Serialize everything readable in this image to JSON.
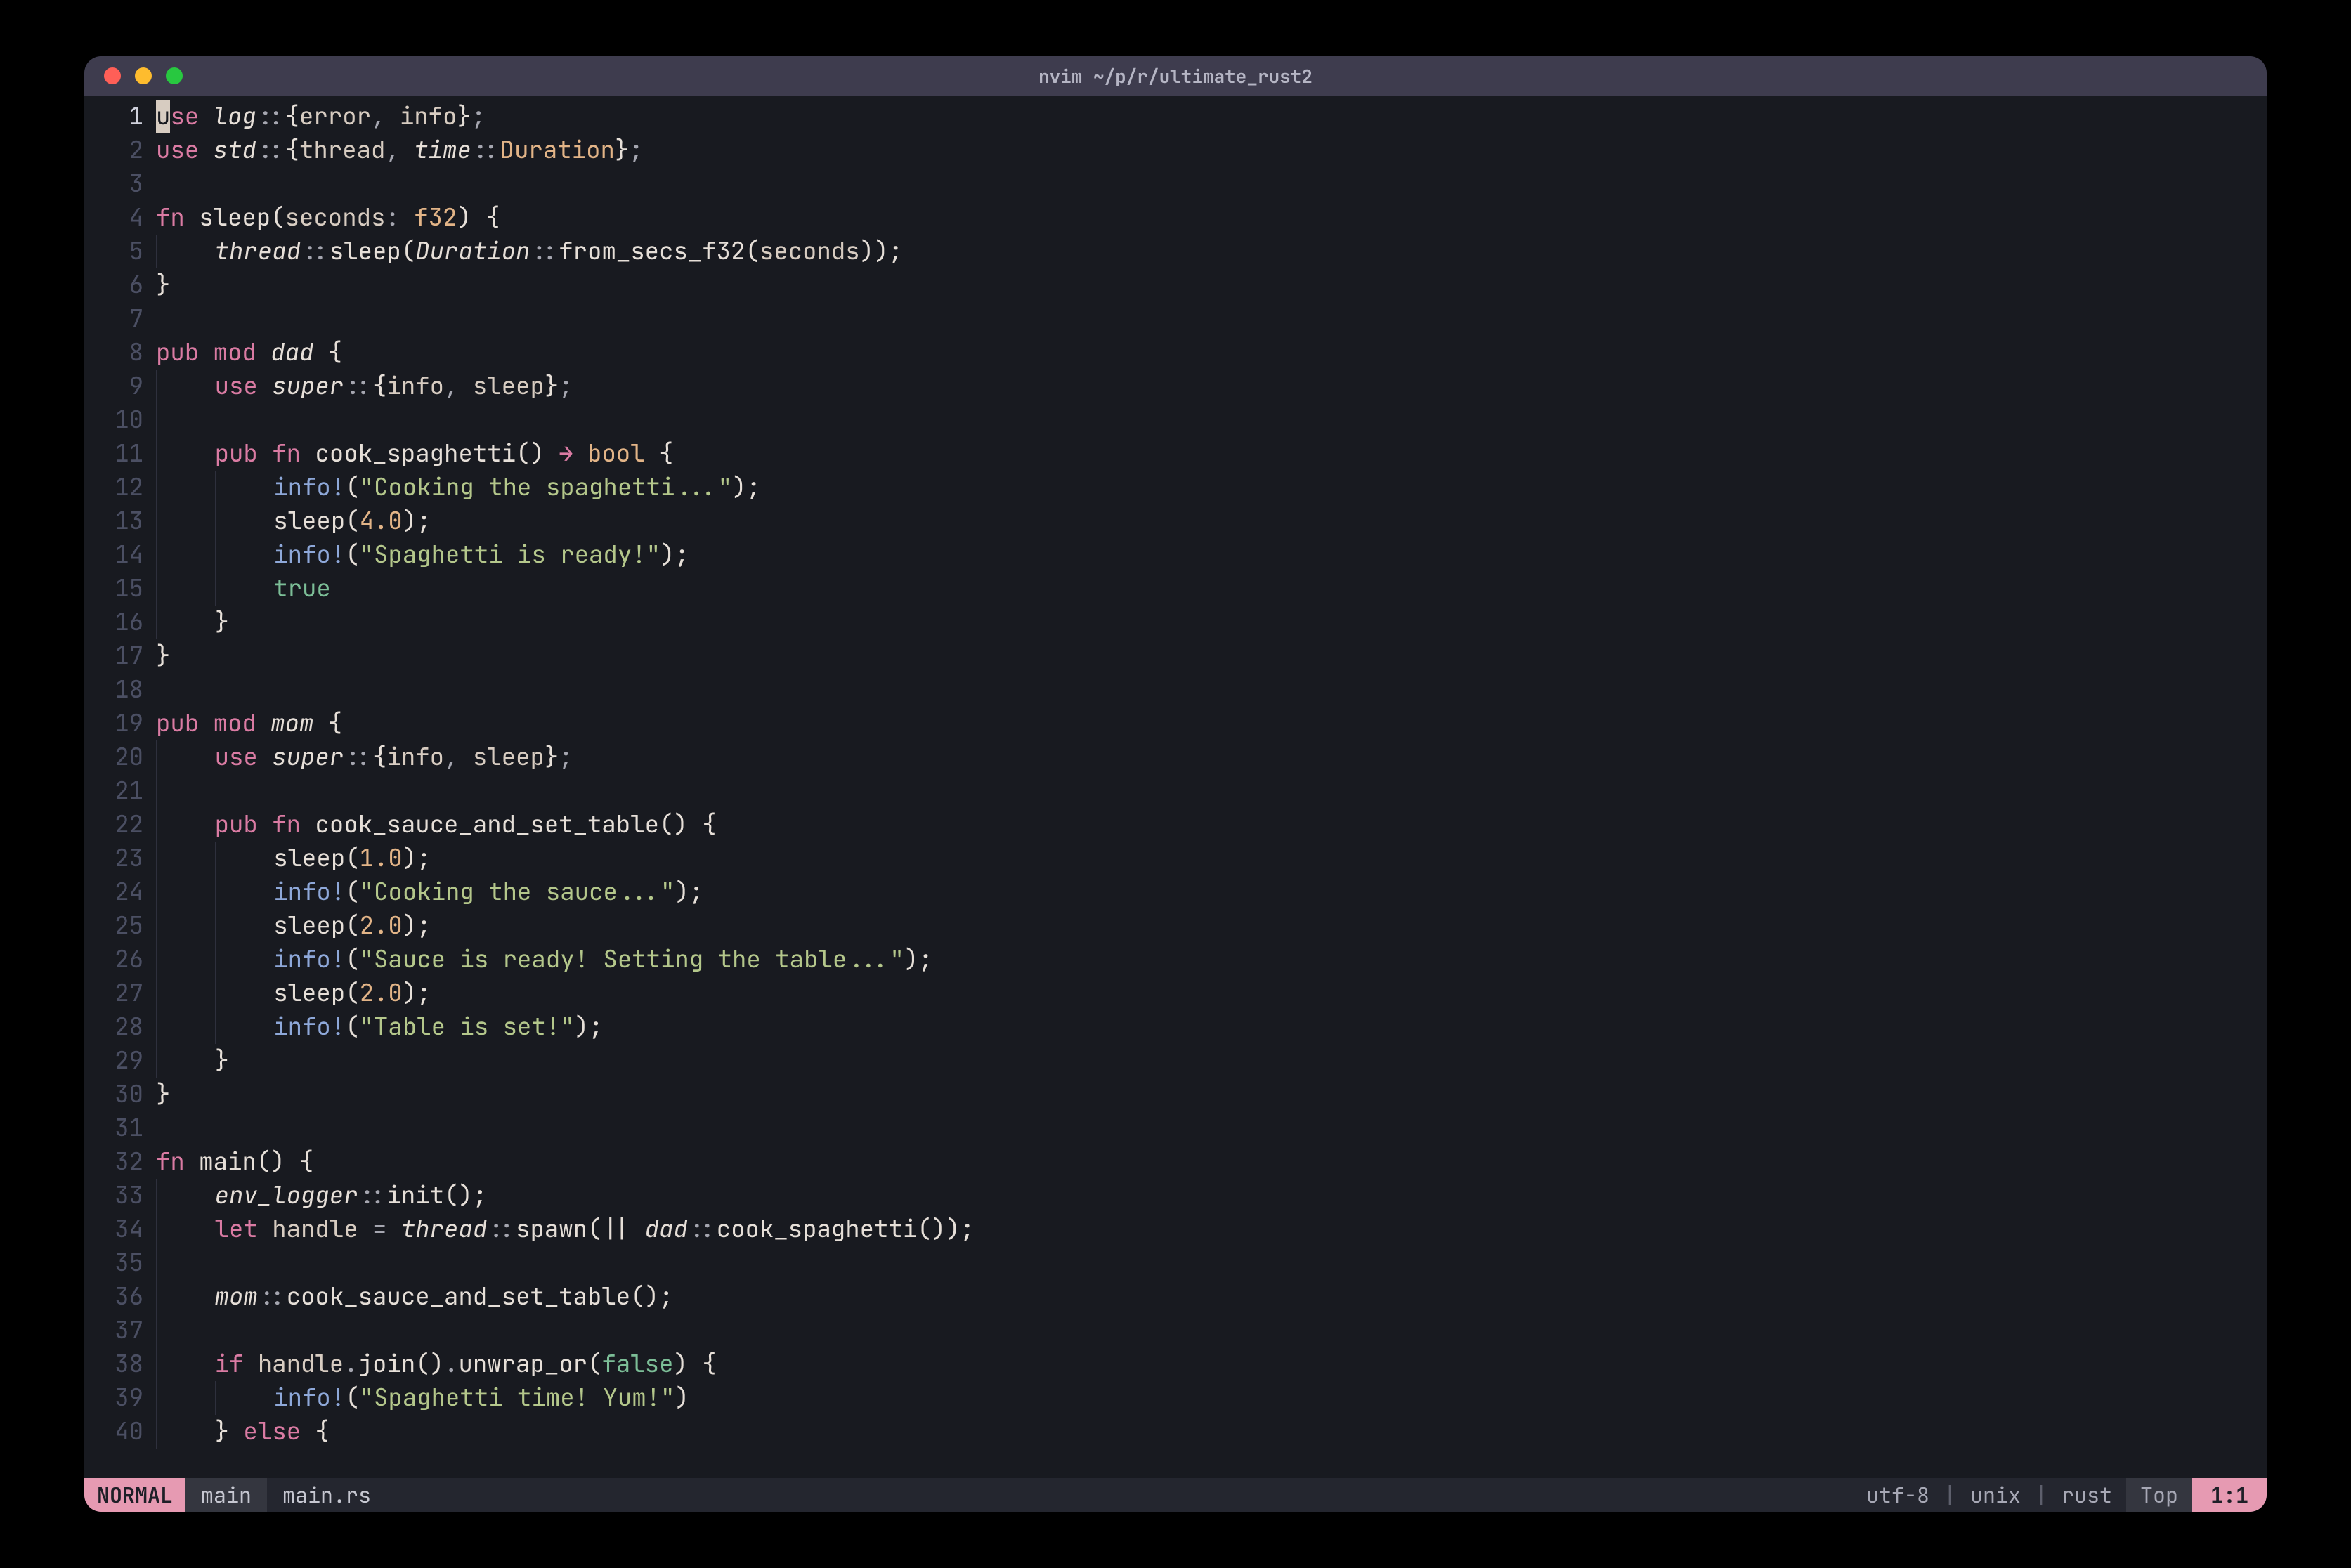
{
  "window": {
    "title": "nvim ~/p/r/ultimate_rust2"
  },
  "editor": {
    "first_line": 1,
    "last_line": 40,
    "cursor_line": 1,
    "lines": [
      {
        "n": 1,
        "tokens": [
          [
            "cursor",
            "u"
          ],
          [
            "kw",
            "se "
          ],
          [
            "it",
            "log"
          ],
          [
            "punct",
            "::"
          ],
          [
            "delim",
            "{"
          ],
          [
            "id",
            "error"
          ],
          [
            "punct",
            ", "
          ],
          [
            "id",
            "info"
          ],
          [
            "delim",
            "}"
          ],
          [
            "punct",
            ";"
          ]
        ]
      },
      {
        "n": 2,
        "tokens": [
          [
            "kw",
            "use "
          ],
          [
            "it",
            "std"
          ],
          [
            "punct",
            "::"
          ],
          [
            "delim",
            "{"
          ],
          [
            "id",
            "thread"
          ],
          [
            "punct",
            ", "
          ],
          [
            "it",
            "time"
          ],
          [
            "punct",
            "::"
          ],
          [
            "type",
            "Duration"
          ],
          [
            "delim",
            "}"
          ],
          [
            "punct",
            ";"
          ]
        ]
      },
      {
        "n": 3,
        "tokens": []
      },
      {
        "n": 4,
        "tokens": [
          [
            "kw",
            "fn "
          ],
          [
            "fn",
            "sleep"
          ],
          [
            "delim",
            "("
          ],
          [
            "id",
            "seconds"
          ],
          [
            "punct",
            ": "
          ],
          [
            "type",
            "f32"
          ],
          [
            "delim",
            ") {"
          ]
        ]
      },
      {
        "n": 5,
        "indent": 1,
        "tokens": [
          [
            "it",
            "thread"
          ],
          [
            "punct",
            "::"
          ],
          [
            "fn",
            "sleep"
          ],
          [
            "delim",
            "("
          ],
          [
            "it",
            "Duration"
          ],
          [
            "punct",
            "::"
          ],
          [
            "fn",
            "from_secs_f32"
          ],
          [
            "delim",
            "("
          ],
          [
            "id",
            "seconds"
          ],
          [
            "delim",
            "));"
          ]
        ]
      },
      {
        "n": 6,
        "tokens": [
          [
            "delim",
            "}"
          ]
        ]
      },
      {
        "n": 7,
        "tokens": []
      },
      {
        "n": 8,
        "tokens": [
          [
            "kw",
            "pub mod "
          ],
          [
            "it",
            "dad"
          ],
          [
            "delim",
            " {"
          ]
        ]
      },
      {
        "n": 9,
        "indent": 1,
        "tokens": [
          [
            "kw",
            "use "
          ],
          [
            "it",
            "super"
          ],
          [
            "punct",
            "::"
          ],
          [
            "delim",
            "{"
          ],
          [
            "id",
            "info"
          ],
          [
            "punct",
            ", "
          ],
          [
            "id",
            "sleep"
          ],
          [
            "delim",
            "}"
          ],
          [
            "punct",
            ";"
          ]
        ]
      },
      {
        "n": 10,
        "indent": 1,
        "tokens": []
      },
      {
        "n": 11,
        "indent": 1,
        "tokens": [
          [
            "kw",
            "pub fn "
          ],
          [
            "fn",
            "cook_spaghetti"
          ],
          [
            "delim",
            "() "
          ],
          [
            "op",
            "→"
          ],
          [
            "delim",
            " "
          ],
          [
            "type",
            "bool"
          ],
          [
            "delim",
            " {"
          ]
        ]
      },
      {
        "n": 12,
        "indent": 2,
        "tokens": [
          [
            "macro",
            "info!"
          ],
          [
            "delim",
            "("
          ],
          [
            "str",
            "\"Cooking the spaghetti...\""
          ],
          [
            "delim",
            ");"
          ]
        ]
      },
      {
        "n": 13,
        "indent": 2,
        "tokens": [
          [
            "fn",
            "sleep"
          ],
          [
            "delim",
            "("
          ],
          [
            "num",
            "4.0"
          ],
          [
            "delim",
            ");"
          ]
        ]
      },
      {
        "n": 14,
        "indent": 2,
        "tokens": [
          [
            "macro",
            "info!"
          ],
          [
            "delim",
            "("
          ],
          [
            "str",
            "\"Spaghetti is ready!\""
          ],
          [
            "delim",
            ");"
          ]
        ]
      },
      {
        "n": 15,
        "indent": 2,
        "tokens": [
          [
            "kw2",
            "true"
          ]
        ]
      },
      {
        "n": 16,
        "indent": 1,
        "tokens": [
          [
            "delim",
            "}"
          ]
        ]
      },
      {
        "n": 17,
        "tokens": [
          [
            "delim",
            "}"
          ]
        ]
      },
      {
        "n": 18,
        "tokens": []
      },
      {
        "n": 19,
        "tokens": [
          [
            "kw",
            "pub mod "
          ],
          [
            "it",
            "mom"
          ],
          [
            "delim",
            " {"
          ]
        ]
      },
      {
        "n": 20,
        "indent": 1,
        "tokens": [
          [
            "kw",
            "use "
          ],
          [
            "it",
            "super"
          ],
          [
            "punct",
            "::"
          ],
          [
            "delim",
            "{"
          ],
          [
            "id",
            "info"
          ],
          [
            "punct",
            ", "
          ],
          [
            "id",
            "sleep"
          ],
          [
            "delim",
            "}"
          ],
          [
            "punct",
            ";"
          ]
        ]
      },
      {
        "n": 21,
        "indent": 1,
        "tokens": []
      },
      {
        "n": 22,
        "indent": 1,
        "tokens": [
          [
            "kw",
            "pub fn "
          ],
          [
            "fn",
            "cook_sauce_and_set_table"
          ],
          [
            "delim",
            "() {"
          ]
        ]
      },
      {
        "n": 23,
        "indent": 2,
        "tokens": [
          [
            "fn",
            "sleep"
          ],
          [
            "delim",
            "("
          ],
          [
            "num",
            "1.0"
          ],
          [
            "delim",
            ");"
          ]
        ]
      },
      {
        "n": 24,
        "indent": 2,
        "tokens": [
          [
            "macro",
            "info!"
          ],
          [
            "delim",
            "("
          ],
          [
            "str",
            "\"Cooking the sauce...\""
          ],
          [
            "delim",
            ");"
          ]
        ]
      },
      {
        "n": 25,
        "indent": 2,
        "tokens": [
          [
            "fn",
            "sleep"
          ],
          [
            "delim",
            "("
          ],
          [
            "num",
            "2.0"
          ],
          [
            "delim",
            ");"
          ]
        ]
      },
      {
        "n": 26,
        "indent": 2,
        "tokens": [
          [
            "macro",
            "info!"
          ],
          [
            "delim",
            "("
          ],
          [
            "str",
            "\"Sauce is ready! Setting the table...\""
          ],
          [
            "delim",
            ");"
          ]
        ]
      },
      {
        "n": 27,
        "indent": 2,
        "tokens": [
          [
            "fn",
            "sleep"
          ],
          [
            "delim",
            "("
          ],
          [
            "num",
            "2.0"
          ],
          [
            "delim",
            ");"
          ]
        ]
      },
      {
        "n": 28,
        "indent": 2,
        "tokens": [
          [
            "macro",
            "info!"
          ],
          [
            "delim",
            "("
          ],
          [
            "str",
            "\"Table is set!\""
          ],
          [
            "delim",
            ");"
          ]
        ]
      },
      {
        "n": 29,
        "indent": 1,
        "tokens": [
          [
            "delim",
            "}"
          ]
        ]
      },
      {
        "n": 30,
        "tokens": [
          [
            "delim",
            "}"
          ]
        ]
      },
      {
        "n": 31,
        "tokens": []
      },
      {
        "n": 32,
        "tokens": [
          [
            "kw",
            "fn "
          ],
          [
            "fn",
            "main"
          ],
          [
            "delim",
            "() {"
          ]
        ]
      },
      {
        "n": 33,
        "indent": 1,
        "tokens": [
          [
            "it",
            "env_logger"
          ],
          [
            "punct",
            "::"
          ],
          [
            "fn",
            "init"
          ],
          [
            "delim",
            "();"
          ]
        ]
      },
      {
        "n": 34,
        "indent": 1,
        "tokens": [
          [
            "kw",
            "let "
          ],
          [
            "id",
            "handle"
          ],
          [
            "punct",
            " = "
          ],
          [
            "it",
            "thread"
          ],
          [
            "punct",
            "::"
          ],
          [
            "fn",
            "spawn"
          ],
          [
            "delim",
            "(|| "
          ],
          [
            "it",
            "dad"
          ],
          [
            "punct",
            "::"
          ],
          [
            "fn",
            "cook_spaghetti"
          ],
          [
            "delim",
            "());"
          ]
        ]
      },
      {
        "n": 35,
        "indent": 1,
        "tokens": []
      },
      {
        "n": 36,
        "indent": 1,
        "tokens": [
          [
            "it",
            "mom"
          ],
          [
            "punct",
            "::"
          ],
          [
            "fn",
            "cook_sauce_and_set_table"
          ],
          [
            "delim",
            "();"
          ]
        ]
      },
      {
        "n": 37,
        "indent": 1,
        "tokens": []
      },
      {
        "n": 38,
        "indent": 1,
        "tokens": [
          [
            "kw",
            "if "
          ],
          [
            "id",
            "handle"
          ],
          [
            "punct",
            "."
          ],
          [
            "fn",
            "join"
          ],
          [
            "delim",
            "()"
          ],
          [
            "punct",
            "."
          ],
          [
            "fn",
            "unwrap_or"
          ],
          [
            "delim",
            "("
          ],
          [
            "kw2",
            "false"
          ],
          [
            "delim",
            ") {"
          ]
        ]
      },
      {
        "n": 39,
        "indent": 2,
        "tokens": [
          [
            "macro",
            "info!"
          ],
          [
            "delim",
            "("
          ],
          [
            "str",
            "\"Spaghetti time! Yum!\""
          ],
          [
            "delim",
            ")"
          ]
        ]
      },
      {
        "n": 40,
        "indent": 1,
        "tokens": [
          [
            "delim",
            "} "
          ],
          [
            "kw",
            "else"
          ],
          [
            "delim",
            " {"
          ]
        ]
      }
    ]
  },
  "statusline": {
    "mode": "NORMAL",
    "branch": "main",
    "filename": "main.rs",
    "encoding": "utf-8",
    "os": "unix",
    "filetype": "rust",
    "scroll": "Top",
    "position": "1:1"
  }
}
